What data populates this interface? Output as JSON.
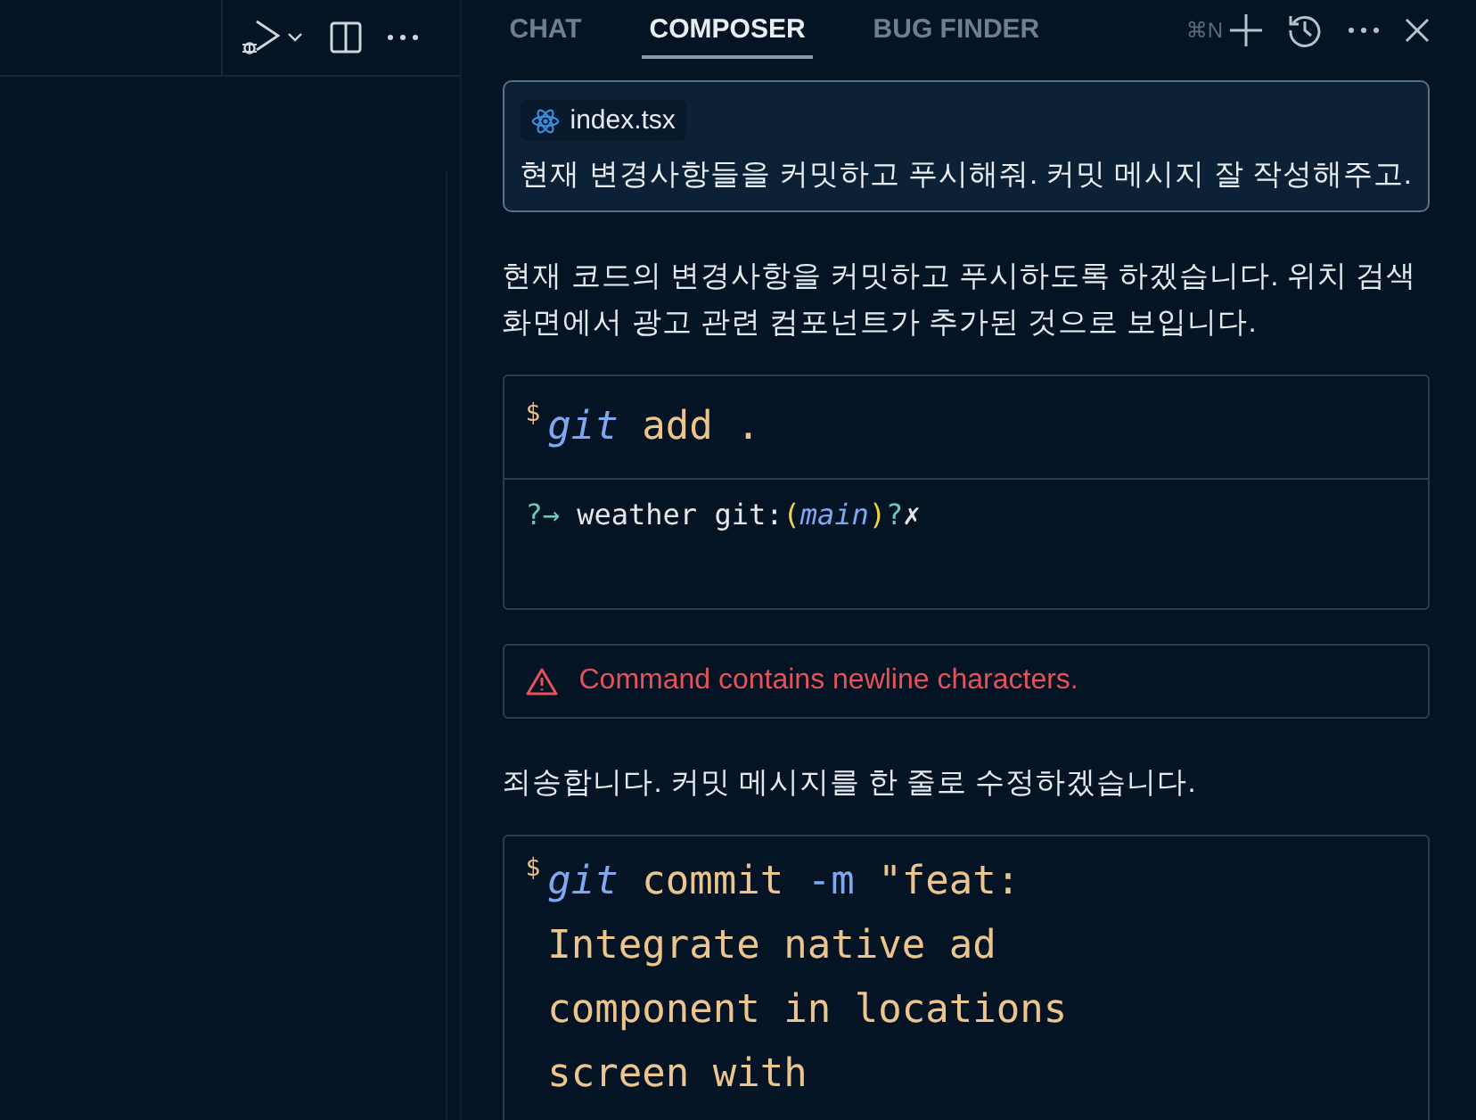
{
  "tabs": [
    {
      "label": "CHAT",
      "selected": false
    },
    {
      "label": "COMPOSER",
      "selected": true
    },
    {
      "label": "BUG FINDER",
      "selected": false
    }
  ],
  "shortcut": "⌘N",
  "prompt": {
    "file_chip": "index.tsx",
    "text": "현재 변경사항들을 커밋하고 푸시해줘. 커밋 메시지 잘 작성해주고."
  },
  "messages": [
    {
      "kind": "text",
      "text": "현재 코드의 변경사항을 커밋하고 푸시하도록 하겠습니다. 위치 검색 화면에서 광고 관련 컴포넌트가 추가된 것으로 보입니다."
    },
    {
      "kind": "command",
      "prompt_sign": "$",
      "lines": [
        [
          {
            "kind": "program",
            "text": "git"
          },
          {
            "kind": "arg",
            "text": "add ."
          }
        ]
      ],
      "output": [
        {
          "kind": "accent",
          "text": "?→"
        },
        {
          "kind": "plain",
          "text": " weather git:"
        },
        {
          "kind": "paren",
          "text": "("
        },
        {
          "kind": "branch",
          "text": "main"
        },
        {
          "kind": "paren",
          "text": ")"
        },
        {
          "kind": "accent",
          "text": "?"
        },
        {
          "kind": "plain",
          "text": "✗"
        }
      ]
    },
    {
      "kind": "error",
      "text": "Command contains newline characters."
    },
    {
      "kind": "text",
      "text": "죄송합니다. 커밋 메시지를 한 줄로 수정하겠습니다."
    },
    {
      "kind": "command",
      "prompt_sign": "$",
      "lines": [
        [
          {
            "kind": "program",
            "text": "git"
          },
          {
            "kind": "arg",
            "text": "commit"
          },
          {
            "kind": "flag",
            "text": "-m"
          },
          {
            "kind": "arg",
            "text": "\"feat:"
          }
        ],
        [
          {
            "kind": "arg",
            "text": "Integrate native ad"
          }
        ],
        [
          {
            "kind": "arg",
            "text": "component in locations"
          }
        ],
        [
          {
            "kind": "arg",
            "text": "screen with"
          }
        ]
      ]
    }
  ]
}
